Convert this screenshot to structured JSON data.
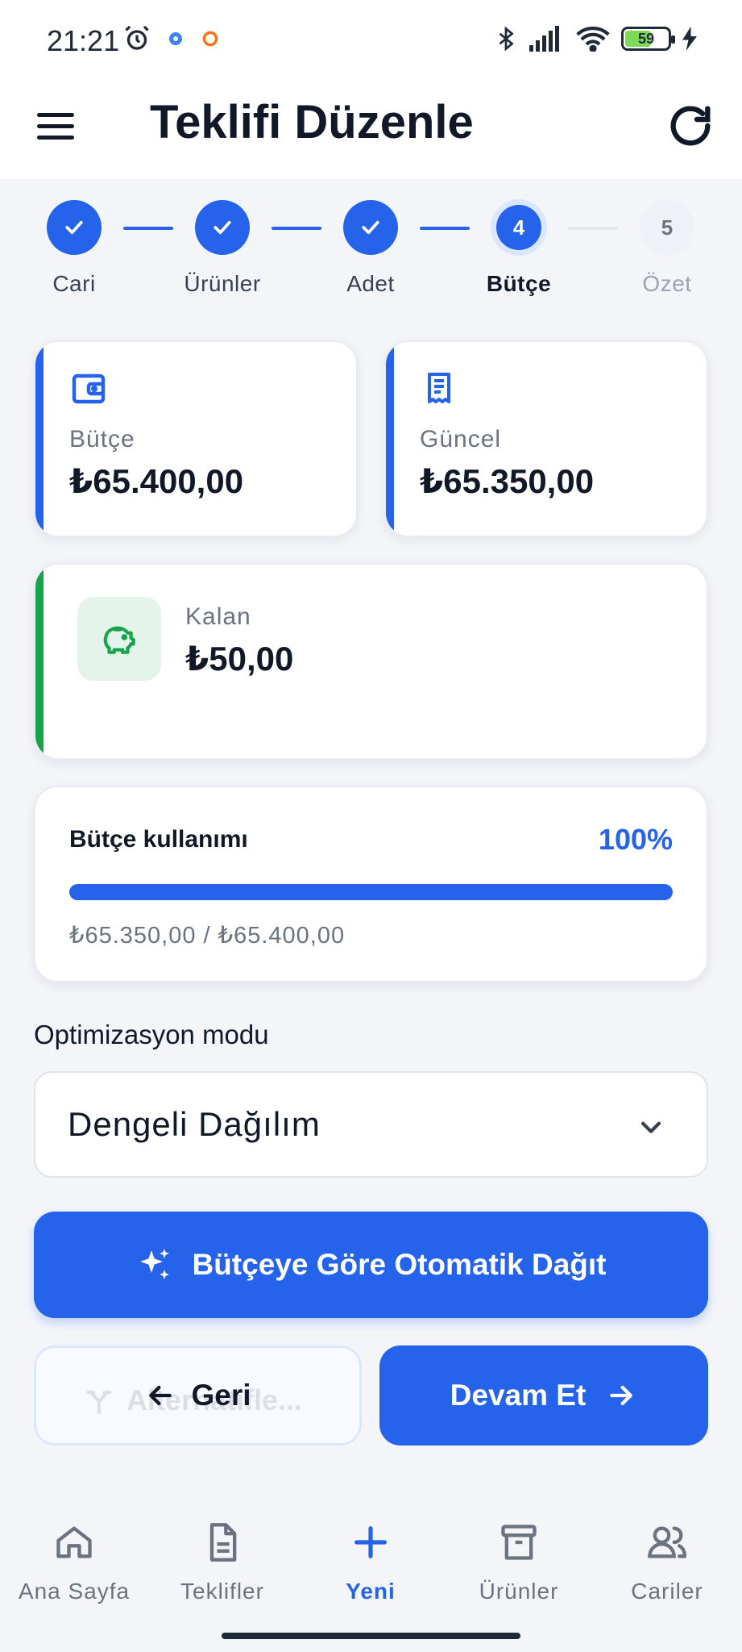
{
  "status_bar": {
    "time": "21:21",
    "battery": "59",
    "icons": [
      "alarm-icon",
      "settings-app-icon",
      "circle-notification-icon",
      "bluetooth-icon",
      "signal-icon",
      "wifi-icon",
      "battery-icon",
      "charging-icon"
    ]
  },
  "app_bar": {
    "title": "Teklifi Düzenle",
    "menu_icon": "menu-icon",
    "refresh_icon": "refresh-icon"
  },
  "stepper": {
    "steps": [
      {
        "label": "Cari",
        "state": "done",
        "number": "1"
      },
      {
        "label": "Ürünler",
        "state": "done",
        "number": "2"
      },
      {
        "label": "Adet",
        "state": "done",
        "number": "3"
      },
      {
        "label": "Bütçe",
        "state": "active",
        "number": "4"
      },
      {
        "label": "Özet",
        "state": "todo",
        "number": "5"
      }
    ]
  },
  "cards": {
    "budget": {
      "label": "Bütçe",
      "value": "₺65.400,00",
      "icon": "wallet-icon",
      "accent": "#2563eb"
    },
    "current": {
      "label": "Güncel",
      "value": "₺65.350,00",
      "icon": "receipt-icon",
      "accent": "#2563eb"
    },
    "remaining": {
      "label": "Kalan",
      "value": "₺50,00",
      "icon": "piggy-bank-icon",
      "accent": "#16a34a"
    }
  },
  "usage": {
    "title": "Bütçe kullanımı",
    "percent_text": "100%",
    "fraction": 1.0,
    "subtext": "₺65.350,00 / ₺65.400,00"
  },
  "optimization": {
    "label": "Optimizasyon modu",
    "selected": "Dengeli Dağılım"
  },
  "actions": {
    "auto_distribute": "Bütçeye Göre Otomatik Dağıt",
    "back": "Geri",
    "back_ghost": "Alternatifle...",
    "next": "Devam Et"
  },
  "bottom_nav": {
    "items": [
      {
        "label": "Ana Sayfa",
        "icon": "home-icon",
        "active": false
      },
      {
        "label": "Teklifler",
        "icon": "document-icon",
        "active": false
      },
      {
        "label": "Yeni",
        "icon": "plus-icon",
        "active": true
      },
      {
        "label": "Ürünler",
        "icon": "archive-icon",
        "active": false
      },
      {
        "label": "Cariler",
        "icon": "users-icon",
        "active": false
      }
    ]
  },
  "colors": {
    "primary": "#2563eb",
    "success": "#16a34a",
    "background": "#f3f5f9"
  }
}
